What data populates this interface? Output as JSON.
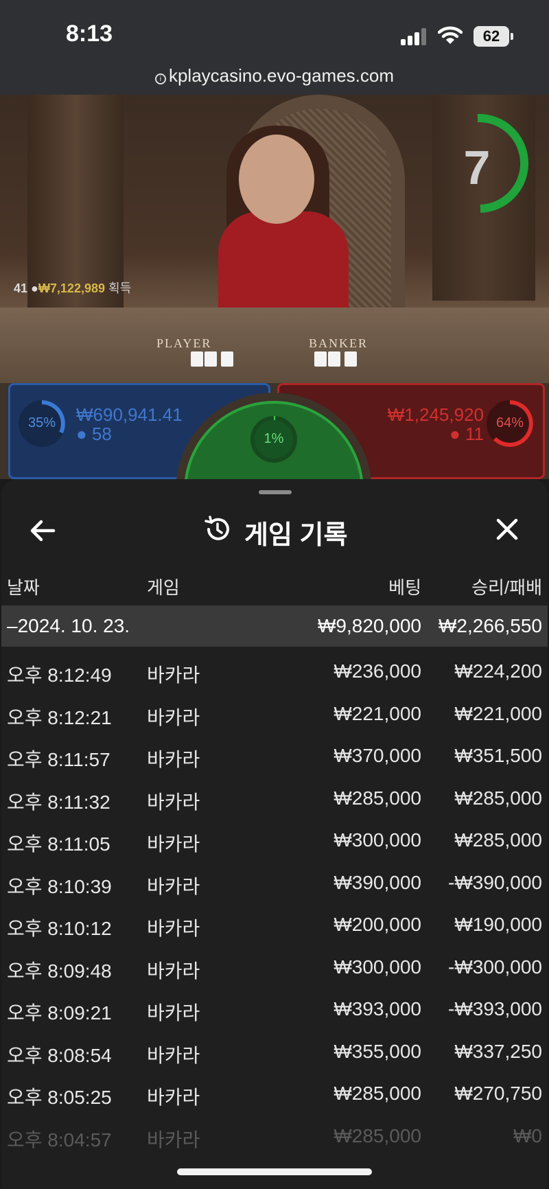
{
  "status": {
    "time": "8:13",
    "battery": "62"
  },
  "browser": {
    "url": "kplaycasino.evo-games.com"
  },
  "video": {
    "timer": "7",
    "winner_count": "41",
    "win_amount": "₩7,122,989",
    "win_label": "획득",
    "player_label": "PLAYER",
    "banker_label": "BANKER"
  },
  "bets": {
    "player": {
      "pct": "35%",
      "amount": "₩690,941.41",
      "count": "58"
    },
    "tie": {
      "pct": "1%"
    },
    "banker": {
      "pct": "64%",
      "amount": "₩1,245,920",
      "count": "11"
    }
  },
  "sheet": {
    "title": "게임 기록",
    "columns": {
      "date": "날짜",
      "game": "게임",
      "bet": "베팅",
      "winloss": "승리/패배"
    },
    "date_group": {
      "date": "–2024. 10. 23.",
      "total_bet": "₩9,820,000",
      "total_winloss": "₩2,266,550"
    },
    "rows": [
      {
        "time": "오후 8:12:49",
        "game": "바카라",
        "bet": "₩236,000",
        "winloss": "₩224,200"
      },
      {
        "time": "오후 8:12:21",
        "game": "바카라",
        "bet": "₩221,000",
        "winloss": "₩221,000"
      },
      {
        "time": "오후 8:11:57",
        "game": "바카라",
        "bet": "₩370,000",
        "winloss": "₩351,500"
      },
      {
        "time": "오후 8:11:32",
        "game": "바카라",
        "bet": "₩285,000",
        "winloss": "₩285,000"
      },
      {
        "time": "오후 8:11:05",
        "game": "바카라",
        "bet": "₩300,000",
        "winloss": "₩285,000"
      },
      {
        "time": "오후 8:10:39",
        "game": "바카라",
        "bet": "₩390,000",
        "winloss": "-₩390,000"
      },
      {
        "time": "오후 8:10:12",
        "game": "바카라",
        "bet": "₩200,000",
        "winloss": "₩190,000"
      },
      {
        "time": "오후 8:09:48",
        "game": "바카라",
        "bet": "₩300,000",
        "winloss": "-₩300,000"
      },
      {
        "time": "오후 8:09:21",
        "game": "바카라",
        "bet": "₩393,000",
        "winloss": "-₩393,000"
      },
      {
        "time": "오후 8:08:54",
        "game": "바카라",
        "bet": "₩355,000",
        "winloss": "₩337,250"
      },
      {
        "time": "오후 8:05:25",
        "game": "바카라",
        "bet": "₩285,000",
        "winloss": "₩270,750"
      },
      {
        "time": "오후 8:04:57",
        "game": "바카라",
        "bet": "₩285,000",
        "winloss": "₩0"
      }
    ]
  },
  "colors": {
    "sheet_bg": "#1f1f1f",
    "date_row_bg": "#3a3a3a",
    "player_blue": "#2b5ba8",
    "banker_red": "#b22626",
    "tie_green": "#2aa33c",
    "timer_green": "#1fa33a"
  }
}
